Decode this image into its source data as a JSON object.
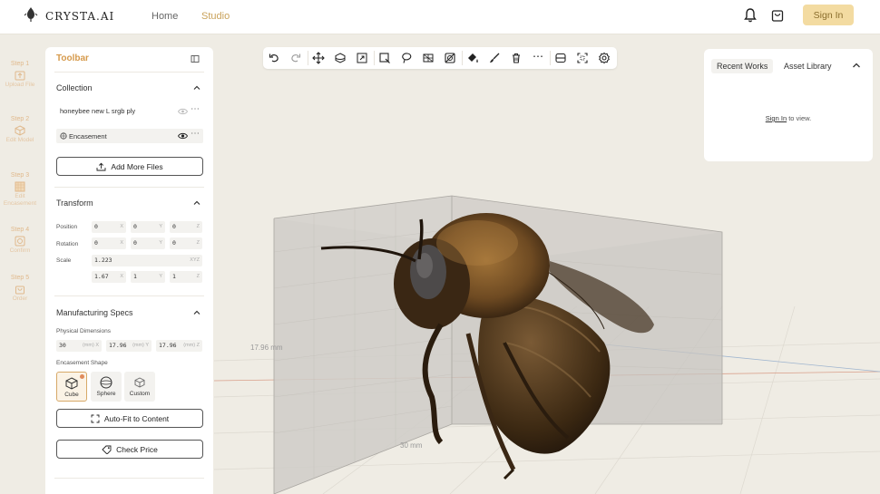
{
  "app": {
    "logo_text": "CRYSTA.AI"
  },
  "nav": {
    "home": "Home",
    "studio": "Studio",
    "sign_in": "Sign In"
  },
  "steps": [
    {
      "num": "Step 1",
      "label": "Upload File",
      "icon": "upload-icon"
    },
    {
      "num": "Step 2",
      "label": "Edit Model",
      "icon": "cube-icon"
    },
    {
      "num": "Step 3",
      "label": "Edit Encasement",
      "icon": "pattern-icon"
    },
    {
      "num": "Step 4",
      "label": "Confirm",
      "icon": "confirm-icon"
    },
    {
      "num": "Step 5",
      "label": "Order",
      "icon": "order-icon"
    }
  ],
  "panel": {
    "title": "Toolbar",
    "collection": {
      "title": "Collection",
      "items": [
        "honeybee new L srgb ply",
        "Encasement"
      ],
      "add_button": "Add More Files"
    },
    "transform": {
      "title": "Transform",
      "position_label": "Position",
      "rotation_label": "Rotation",
      "scale_label": "Scale",
      "position": [
        "0",
        "0",
        "0"
      ],
      "rotation": [
        "0",
        "0",
        "0"
      ],
      "scale_uniform": "1.223",
      "scale_xyz": [
        "1.67",
        "1",
        "1"
      ],
      "axes": [
        "X",
        "Y",
        "Z"
      ],
      "xyz": "XYZ"
    },
    "manufacturing": {
      "title": "Manufacturing Specs",
      "physical_label": "Physical Dimensions",
      "dims": [
        "30",
        "17.96",
        "17.96"
      ],
      "dim_axes": [
        "(mm) X",
        "(mm) Y",
        "(mm) Z"
      ],
      "shape_label": "Encasement Shape",
      "shapes": [
        "Cube",
        "Sphere",
        "Custom"
      ],
      "autofit": "Auto-Fit to Content",
      "check_price": "Check Price"
    }
  },
  "viewport": {
    "dim_label_y": "17.96 mm",
    "dim_label_x": "30 mm"
  },
  "right_panel": {
    "tabs": [
      "Recent Works",
      "Asset Library"
    ],
    "sign_in_link": "Sign In",
    "message_suffix": " to view."
  },
  "colors": {
    "accent": "#d69a4c",
    "signin_bg": "#f3dba1",
    "steps": "#e0b98c"
  }
}
